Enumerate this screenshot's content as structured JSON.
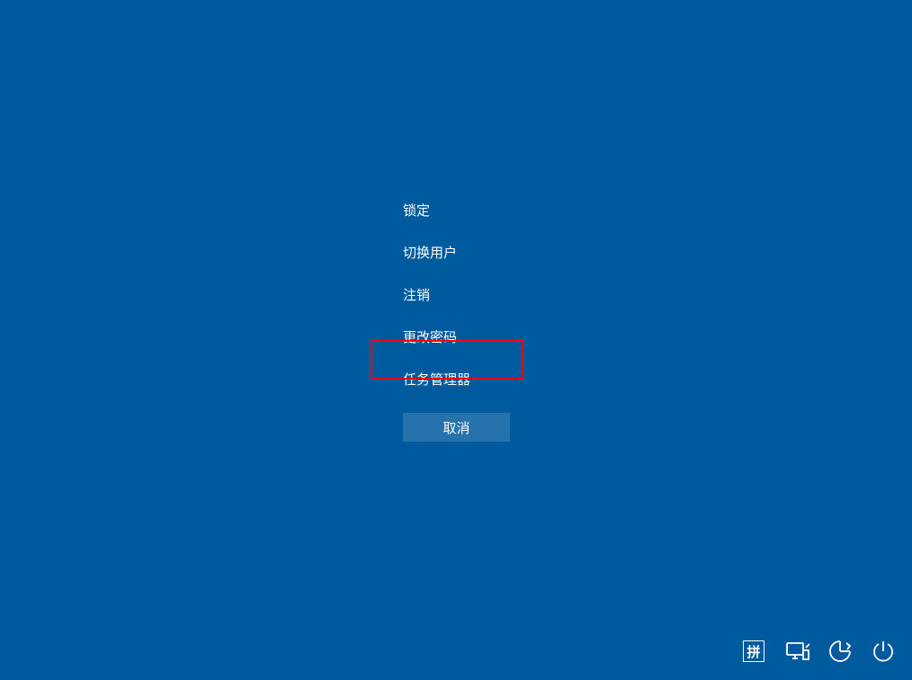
{
  "menu": {
    "items": [
      {
        "label": "锁定"
      },
      {
        "label": "切换用户"
      },
      {
        "label": "注销"
      },
      {
        "label": "更改密码"
      },
      {
        "label": "任务管理器"
      }
    ]
  },
  "cancel_button_label": "取消",
  "ime_label": "拼",
  "highlighted_index": 4,
  "icons": {
    "ime": "ime-icon",
    "network": "network-icon",
    "ease_of_access": "ease-of-access-icon",
    "power": "power-icon"
  }
}
